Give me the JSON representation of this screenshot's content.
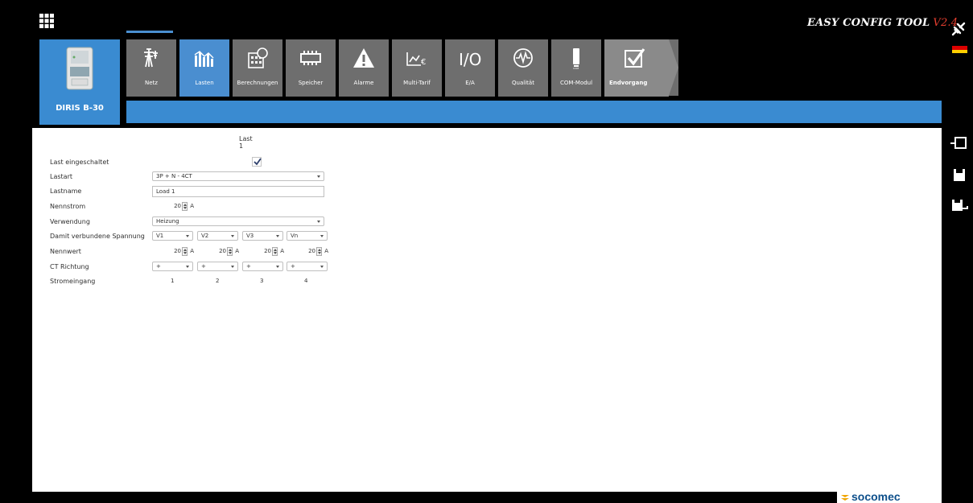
{
  "app": {
    "title": "EASY CONFIG TOOL",
    "version": "V2.4",
    "device_name": "DIRIS B-30",
    "brand": "socomec"
  },
  "tabs": [
    {
      "label": "Netz",
      "icon": "grid-tower-icon"
    },
    {
      "label": "Lasten",
      "icon": "bar-chart-icon"
    },
    {
      "label": "Berechnungen",
      "icon": "calculator-icon"
    },
    {
      "label": "Speicher",
      "icon": "memory-icon"
    },
    {
      "label": "Alarme",
      "icon": "warning-icon"
    },
    {
      "label": "Multi-Tarif",
      "icon": "tariff-icon"
    },
    {
      "label": "E/A",
      "icon": "io-icon"
    },
    {
      "label": "Qualität",
      "icon": "waveform-icon"
    },
    {
      "label": "COM-Modul",
      "icon": "com-module-icon"
    },
    {
      "label": "Endvorgang",
      "icon": "checkmark-icon"
    }
  ],
  "form": {
    "load_title": "Last 1",
    "labels": {
      "enabled": "Last eingeschaltet",
      "type": "Lastart",
      "name": "Lastname",
      "rated_current": "Nennstrom",
      "usage": "Verwendung",
      "voltages": "Damit verbundene Spannung",
      "nominal": "Nennwert",
      "ct_direction": "CT Richtung",
      "current_input": "Stromeingang"
    },
    "values": {
      "type": "3P + N - 4CT",
      "name": "Load 1",
      "rated_current": "20",
      "rated_unit": "A",
      "usage": "Heizung",
      "voltages": [
        "V1",
        "V2",
        "V3",
        "Vn"
      ],
      "nominal": [
        "20",
        "20",
        "20",
        "20"
      ],
      "nominal_unit": "A",
      "ct": [
        "+",
        "+",
        "+",
        "+"
      ],
      "inputs": [
        "1",
        "2",
        "3",
        "4"
      ]
    }
  },
  "colors": {
    "accent": "#3a8bd1",
    "tab_bg": "#6e6e6e",
    "version_red": "#e53e2f"
  }
}
